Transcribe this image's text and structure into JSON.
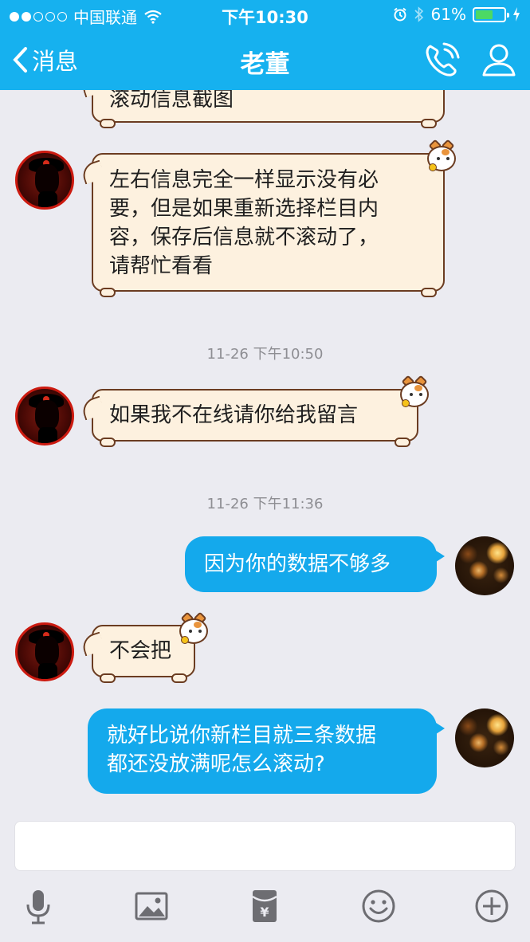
{
  "status_bar": {
    "carrier": "中国联通",
    "time": "下午10:30",
    "battery": "61%",
    "battery_level": 0.61
  },
  "nav": {
    "back_label": "消息",
    "title": "老董",
    "icons": [
      "phone-icon",
      "profile-icon"
    ]
  },
  "messages": [
    {
      "side": "left",
      "text_lines": [
        "滚动信息截图"
      ]
    },
    {
      "side": "left",
      "text_lines": [
        "左右信息完全一样显示没有必",
        "要，但是如果重新选择栏目内",
        "容，保存后信息就不滚动了，",
        "请帮忙看看"
      ]
    },
    {
      "timestamp": "11-26 下午10:50"
    },
    {
      "side": "left",
      "text_lines": [
        "如果我不在线请你给我留言"
      ]
    },
    {
      "timestamp": "11-26 下午11:36"
    },
    {
      "side": "right",
      "text_lines": [
        "因为你的数据不够多"
      ]
    },
    {
      "side": "left",
      "text_lines": [
        "不会把"
      ]
    },
    {
      "side": "right",
      "text_lines": [
        "就好比说你新栏目就三条数据",
        "都还没放满呢怎么滚动?"
      ]
    }
  ],
  "input": {
    "value": "",
    "placeholder": ""
  },
  "toolbar": [
    "microphone-icon",
    "image-icon",
    "red-packet-icon",
    "emoji-icon",
    "add-icon"
  ],
  "colors": {
    "accent": "#16b1ef",
    "bubble_right": "#14a9ec",
    "bubble_left": "#fdf1df",
    "background": "#ebebf1"
  }
}
